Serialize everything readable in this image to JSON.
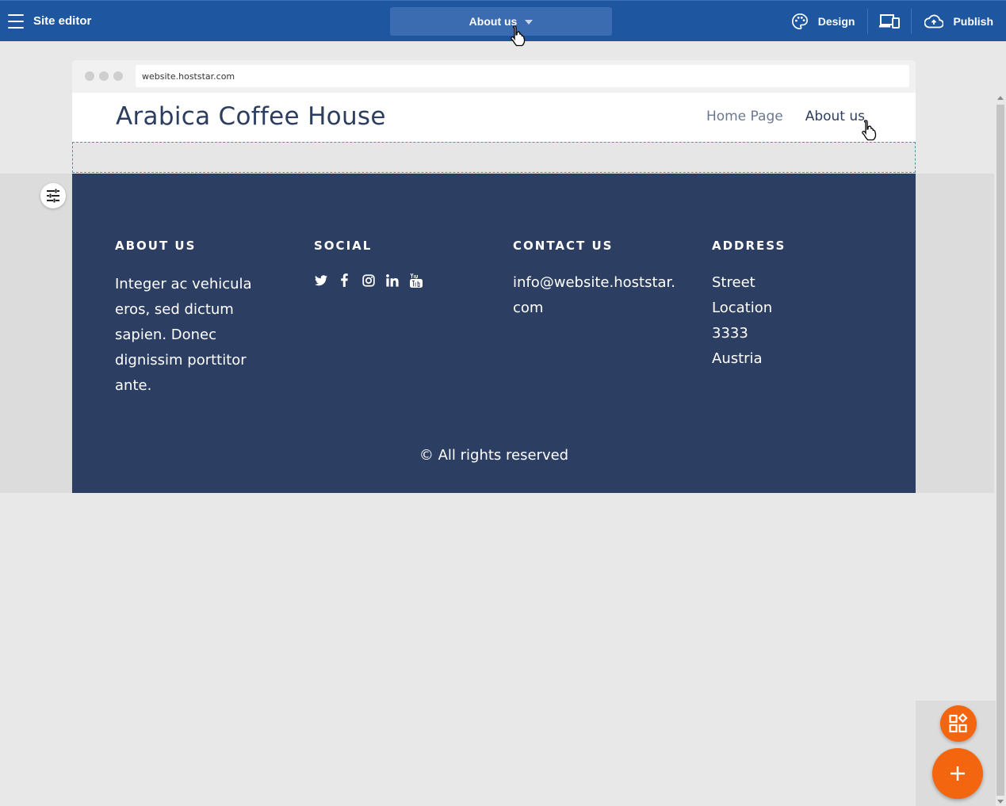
{
  "editor": {
    "title": "Site editor",
    "current_page": "About us",
    "design_label": "Design",
    "publish_label": "Publish"
  },
  "browser": {
    "url": "website.hoststar.com"
  },
  "site": {
    "brand": "Arabica Coffee House",
    "nav": [
      "Home Page",
      "About us"
    ]
  },
  "footer": {
    "about": {
      "heading": "ABOUT US",
      "text": "Integer ac vehicula eros, sed dictum sapien. Donec dignissim porttitor ante."
    },
    "social": {
      "heading": "SOCIAL",
      "icons": [
        "twitter-icon",
        "facebook-icon",
        "instagram-icon",
        "linkedin-icon",
        "youtube-icon"
      ]
    },
    "contact": {
      "heading": "CONTACT US",
      "email": "info@website.hoststar.com"
    },
    "address": {
      "heading": "ADDRESS",
      "line1": "Street",
      "line2": "Location",
      "line3": "3333",
      "line4": "Austria"
    },
    "copyright": "© All rights reserved"
  },
  "colors": {
    "topbar": "#1e56a0",
    "footer": "#2c3e61",
    "accent": "#f4650f"
  }
}
